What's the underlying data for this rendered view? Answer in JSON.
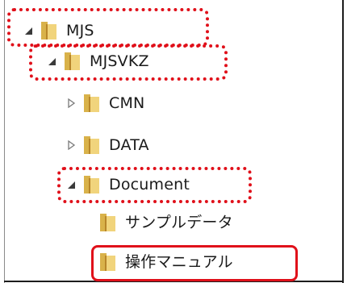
{
  "tree": {
    "nodes": [
      {
        "label": "MJS",
        "expanded": true,
        "icon": "folder-icon"
      },
      {
        "label": "MJSVKZ",
        "expanded": true,
        "icon": "folder-icon"
      },
      {
        "label": "CMN",
        "expanded": false,
        "icon": "folder-icon"
      },
      {
        "label": "DATA",
        "expanded": false,
        "icon": "folder-icon"
      },
      {
        "label": "Document",
        "expanded": true,
        "icon": "folder-icon"
      },
      {
        "label": "サンプルデータ",
        "icon": "folder-icon"
      },
      {
        "label": "操作マニュアル",
        "icon": "folder-icon"
      }
    ]
  },
  "colors": {
    "highlight": "#e0101a",
    "folder_front": "#f1d47c",
    "folder_back": "#d9b24a",
    "folder_spine": "#b8862a"
  }
}
